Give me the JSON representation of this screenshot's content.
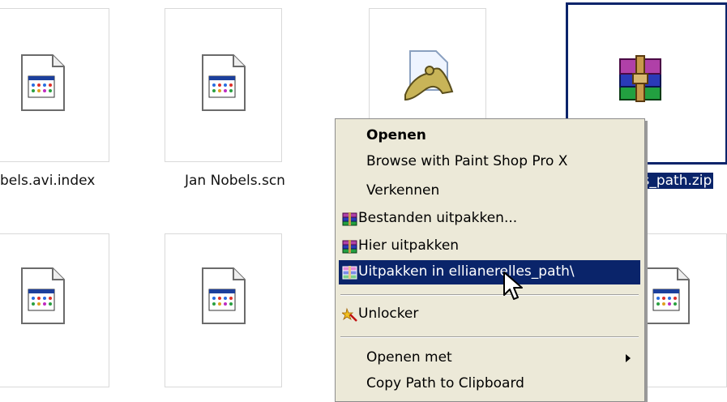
{
  "files": [
    {
      "name": "bels.avi.index",
      "icon": "document-app-icon"
    },
    {
      "name": "Jan Nobels.scn",
      "icon": "document-app-icon"
    },
    {
      "name": "",
      "icon": "paint-shop-pro-icon"
    },
    {
      "name": "es_path.zip",
      "icon": "winrar-archive-icon",
      "selected": true
    },
    {
      "name": "",
      "icon": "document-app-icon"
    },
    {
      "name": "",
      "icon": "document-app-icon"
    },
    {
      "name": "",
      "icon": "document-icon"
    },
    {
      "name": "",
      "icon": "document-app-icon"
    }
  ],
  "context_menu": {
    "items": [
      {
        "label": "Openen",
        "bold": true
      },
      {
        "label": "Browse with Paint Shop Pro X"
      },
      {
        "label": "Verkennen"
      },
      {
        "label": "Bestanden uitpakken...",
        "icon": "winrar-icon"
      },
      {
        "label": "Hier uitpakken",
        "icon": "winrar-icon"
      },
      {
        "label": "Uitpakken in ellianerelles_path\\",
        "icon": "winrar-icon",
        "highlighted": true
      },
      {
        "label": "Unlocker",
        "icon": "unlocker-icon"
      },
      {
        "label": "Openen met",
        "submenu": true
      },
      {
        "label": "Copy Path to Clipboard"
      }
    ]
  },
  "colors": {
    "selection": "#0a246a",
    "menu_bg": "#ece9d8"
  }
}
